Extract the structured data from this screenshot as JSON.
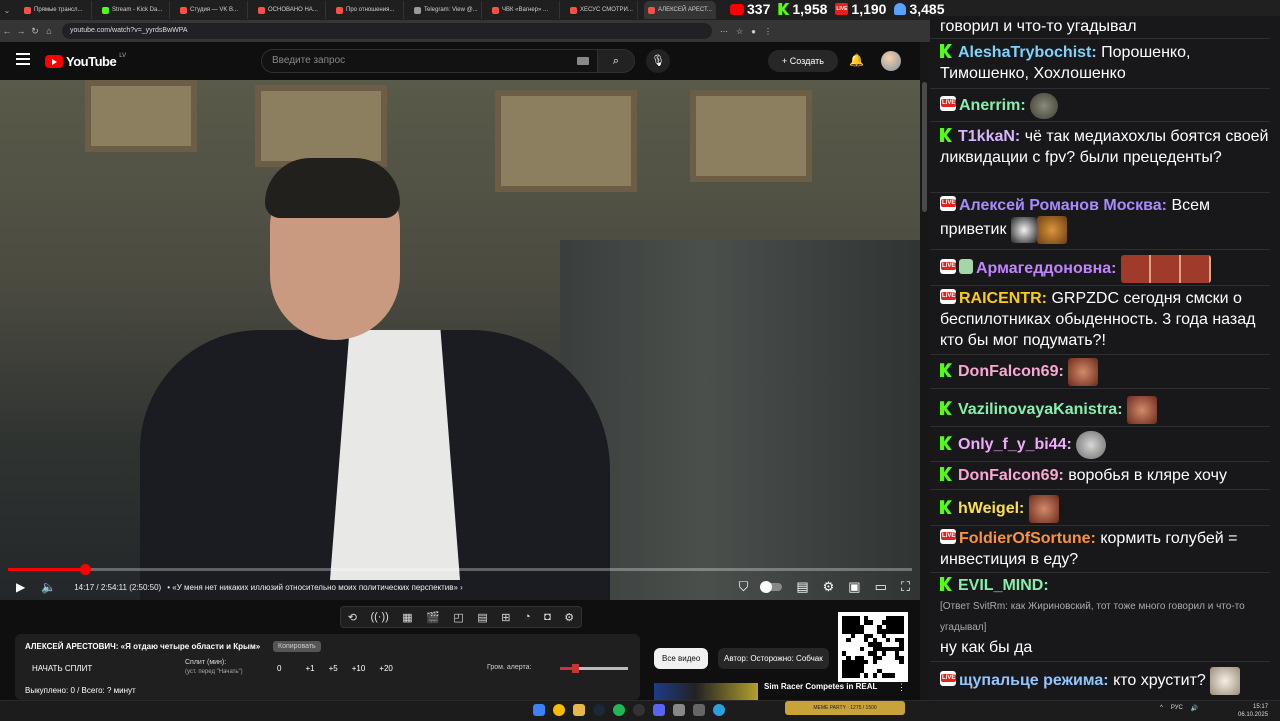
{
  "browser": {
    "tabs": [
      {
        "label": "Прямые трансл...",
        "color": "#ff4e45"
      },
      {
        "label": "Stream - Kick Da...",
        "color": "#53fc18"
      },
      {
        "label": "Студия — VK В...",
        "color": "#ff4e45"
      },
      {
        "label": "ОСНОВАНО НА...",
        "color": "#ff4e45"
      },
      {
        "label": "Про отношения...",
        "color": "#ff4e45"
      },
      {
        "label": "Telegram: View @...",
        "color": "#999999"
      },
      {
        "label": "ЧВК «Вагнер» ...",
        "color": "#ff4e45"
      },
      {
        "label": "ХЕСУС СМОТРИ...",
        "color": "#ff4e45"
      },
      {
        "label": "АЛЕКСЕЙ АРЕСТ...",
        "color": "#ff4e45"
      }
    ],
    "url": "youtube.com/watch?v=_yyrdsBwWPA"
  },
  "counters": {
    "youtube": "337",
    "kick": "1,958",
    "live": "1,190",
    "viewers": "3,485"
  },
  "youtube": {
    "logo_word": "YouTube",
    "region": "LV",
    "search_placeholder": "Введите запрос",
    "create_label": "Создать",
    "player": {
      "progress": 0.085,
      "time": "14:17 / 2:54:11 (2:50:50)",
      "chapter": "• «У меня нет никаких иллюзий относительно моих политических перспектив» ›"
    },
    "panel": {
      "title": "АЛЕКСЕЙ АРЕСТОВИЧ: «Я отдаю четыре области и Крым»",
      "copy": "Копировать",
      "split_button": "НАЧАТЬ СПЛИТ",
      "split_label": "Сплит (мин):",
      "split_sub": "(уст. перед \"Начать\")",
      "nums": [
        "0",
        "+1",
        "+5",
        "+10",
        "+20"
      ],
      "alert_label": "Гром. алерта:",
      "bought": "Выкуплено: 0 / Всего: ? минут"
    },
    "filters": {
      "all": "Все видео",
      "author": "Автор: Осторожно: Собчак"
    },
    "rec_title": "Sim Racer Competes in REAL"
  },
  "chat": {
    "messages": [
      {
        "text": "говорил и что-то угадывал"
      },
      {
        "badge": "kick",
        "user": "AleshaTrybochist:",
        "color": "#7dd3fc",
        "text": " Порошенко, Тимошенко, Хохлошенко"
      },
      {
        "badge": "live",
        "user": "Anerrim:",
        "color": "#86efac",
        "text": ""
      },
      {
        "badge": "kick",
        "user": "T1kkaN:",
        "color": "#d8b4fe",
        "text": " чё так медиахохлы боятся своей ликвидации с fpv? были прецеденты?"
      },
      {
        "badge": "live",
        "user": "Алексей Романов Москва:",
        "color": "#a78bfa",
        "text": " Всем приветик"
      },
      {
        "badge": "live",
        "user": "Армагеддоновна:",
        "color": "#c084fc",
        "text": ""
      },
      {
        "badge": "live",
        "user": "RAICENTR:",
        "color": "#facc15",
        "text": " GRPZDC сегодня смски о беспилотниках обыденность. 3 года назад кто бы мог подумать?!"
      },
      {
        "badge": "kick",
        "user": "DonFalcon69:",
        "color": "#f9a8d4",
        "text": ""
      },
      {
        "badge": "kick",
        "user": "VazilinovayaKanistra:",
        "color": "#86efac",
        "text": ""
      },
      {
        "badge": "kick",
        "user": "Only_f_y_bi44:",
        "color": "#f0abfc",
        "text": ""
      },
      {
        "badge": "kick",
        "user": "DonFalcon69:",
        "color": "#f9a8d4",
        "text": " воробья в кляре хочу"
      },
      {
        "badge": "kick",
        "user": "hWeigel:",
        "color": "#fde047",
        "text": ""
      },
      {
        "badge": "live",
        "user": "FoldierOfSortune:",
        "color": "#fb923c",
        "text": " кормить голубей = инвестиция в еду?"
      },
      {
        "badge": "kick",
        "user": "EVIL_MIND:",
        "color": "#86efac",
        "text": ""
      },
      {
        "reply": "[Ответ SvitRm: как Жириновский, тот тоже много говорил и что-то угадывал]"
      },
      {
        "text": "ну как бы да"
      },
      {
        "badge": "live",
        "user": "щупальце режима:",
        "color": "#93c5fd",
        "text": " кто хрустит?"
      }
    ]
  },
  "taskbar": {
    "banner": "MEME PARTY · 1275 / 1500",
    "lang": "РУС",
    "time": "15:17",
    "date": "06.10.2025"
  }
}
